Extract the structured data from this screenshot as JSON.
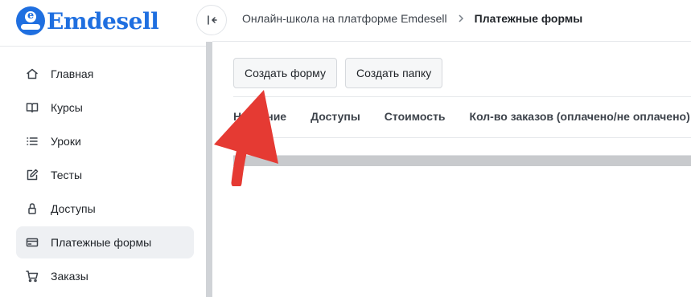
{
  "brand": {
    "name": "Emdesell",
    "color": "#1f6fe0"
  },
  "sidebar": {
    "items": [
      {
        "label": "Главная",
        "icon": "home-icon"
      },
      {
        "label": "Курсы",
        "icon": "book-icon"
      },
      {
        "label": "Уроки",
        "icon": "list-icon"
      },
      {
        "label": "Тесты",
        "icon": "edit-icon"
      },
      {
        "label": "Доступы",
        "icon": "lock-icon"
      },
      {
        "label": "Платежные формы",
        "icon": "credit-card-icon",
        "active": true
      },
      {
        "label": "Заказы",
        "icon": "cart-icon"
      }
    ]
  },
  "header": {
    "breadcrumb": [
      "Онлайн-школа на платформе Emdesell",
      "Платежные формы"
    ]
  },
  "toolbar": {
    "create_form_label": "Создать форму",
    "create_folder_label": "Создать папку"
  },
  "table": {
    "columns": [
      "Название",
      "Доступы",
      "Стоимость",
      "Кол-во заказов (оплачено/не оплачено)"
    ]
  },
  "annotation": {
    "color": "#e53a33"
  }
}
